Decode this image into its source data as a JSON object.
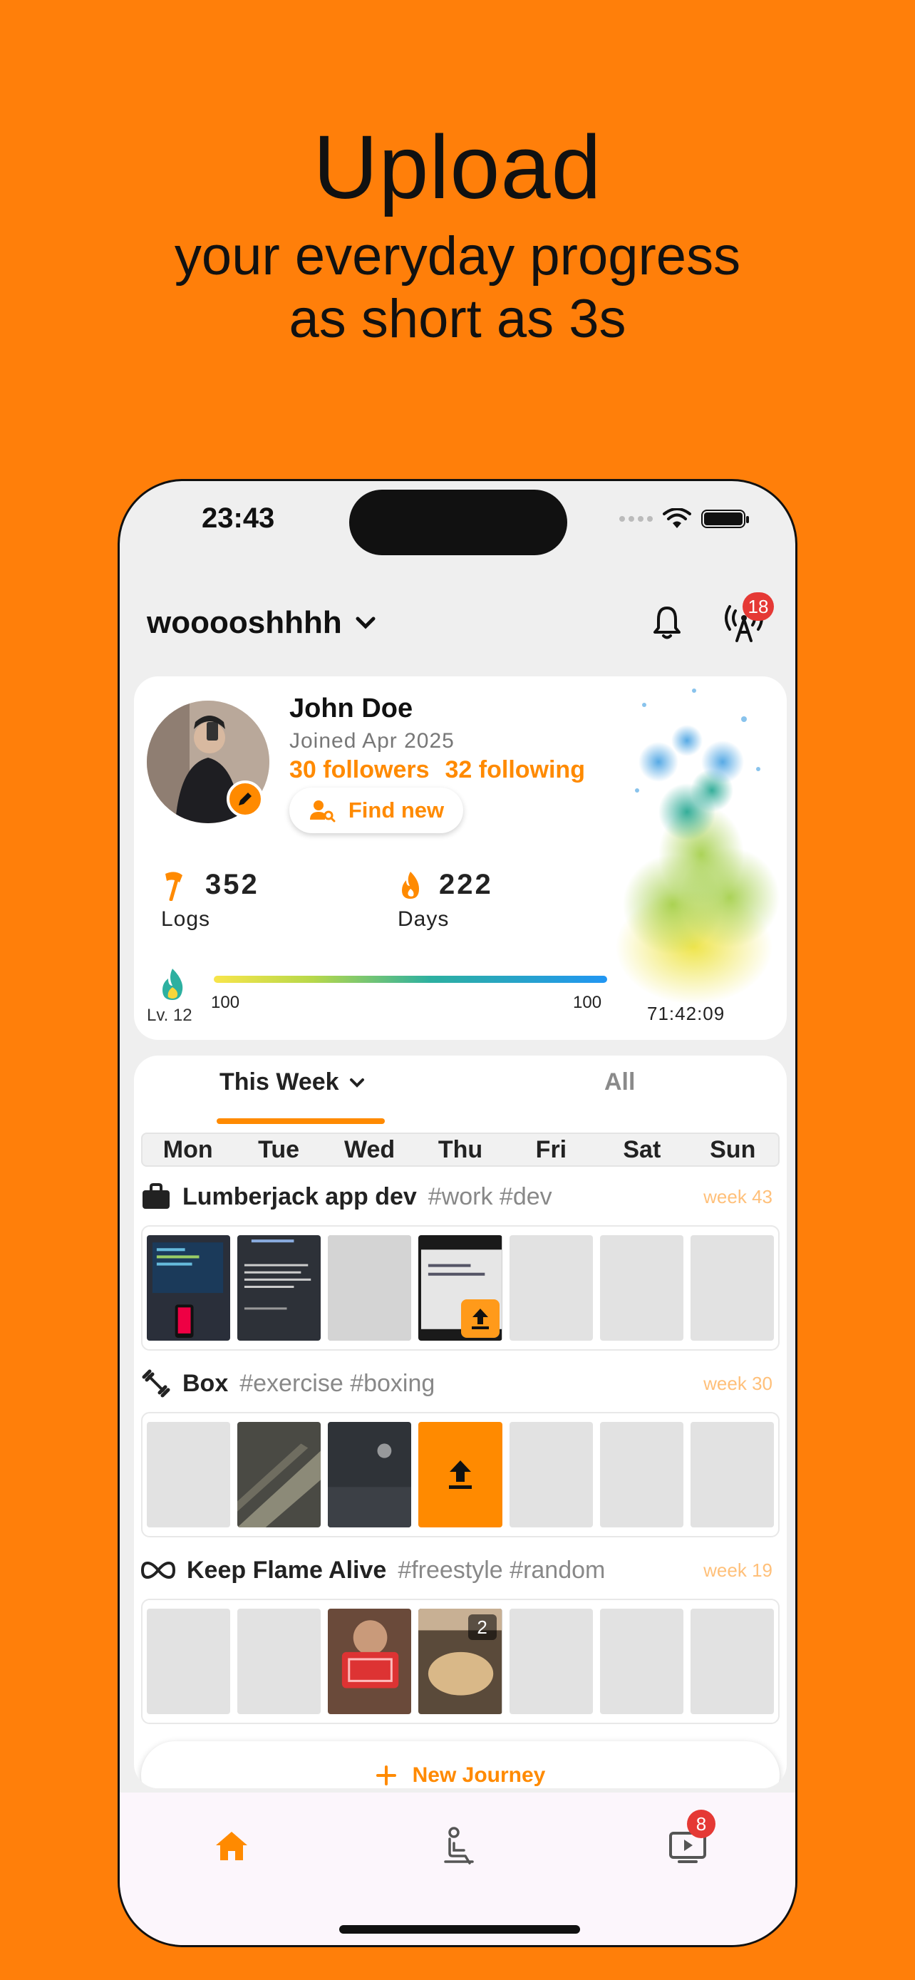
{
  "hero": {
    "title": "Upload",
    "subtitle_line1": "your everyday progress",
    "subtitle_line2": "as short as 3s"
  },
  "status_bar": {
    "time": "23:43"
  },
  "header": {
    "username": "wooooshhhh",
    "broadcast_badge": "18"
  },
  "profile": {
    "name": "John Doe",
    "joined": "Joined Apr 2025",
    "followers": "30 followers",
    "following": "32 following",
    "find_new_label": "Find new",
    "logs_value": "352",
    "logs_label": "Logs",
    "days_value": "222",
    "days_label": "Days",
    "level": "Lv. 12",
    "xp_min": "100",
    "xp_max": "100",
    "timer": "71:42:09"
  },
  "tabs": {
    "active": "This Week",
    "inactive": "All"
  },
  "weekdays": [
    "Mon",
    "Tue",
    "Wed",
    "Thu",
    "Fri",
    "Sat",
    "Sun"
  ],
  "journeys": [
    {
      "name": "Lumberjack app dev",
      "tags": "#work #dev",
      "week": "week 43",
      "icon": "briefcase-icon"
    },
    {
      "name": "Box",
      "tags": "#exercise #boxing",
      "week": "week 30",
      "icon": "dumbbell-icon"
    },
    {
      "name": "Keep Flame Alive",
      "tags": "#freestyle #random",
      "week": "week 19",
      "icon": "infinity-icon",
      "thu_count": "2"
    }
  ],
  "new_journey_label": "New Journey",
  "bottom_nav": {
    "inbox_badge": "8"
  },
  "colors": {
    "accent": "#FF8A00",
    "background": "#FF7F0A",
    "badge": "#E53935"
  }
}
